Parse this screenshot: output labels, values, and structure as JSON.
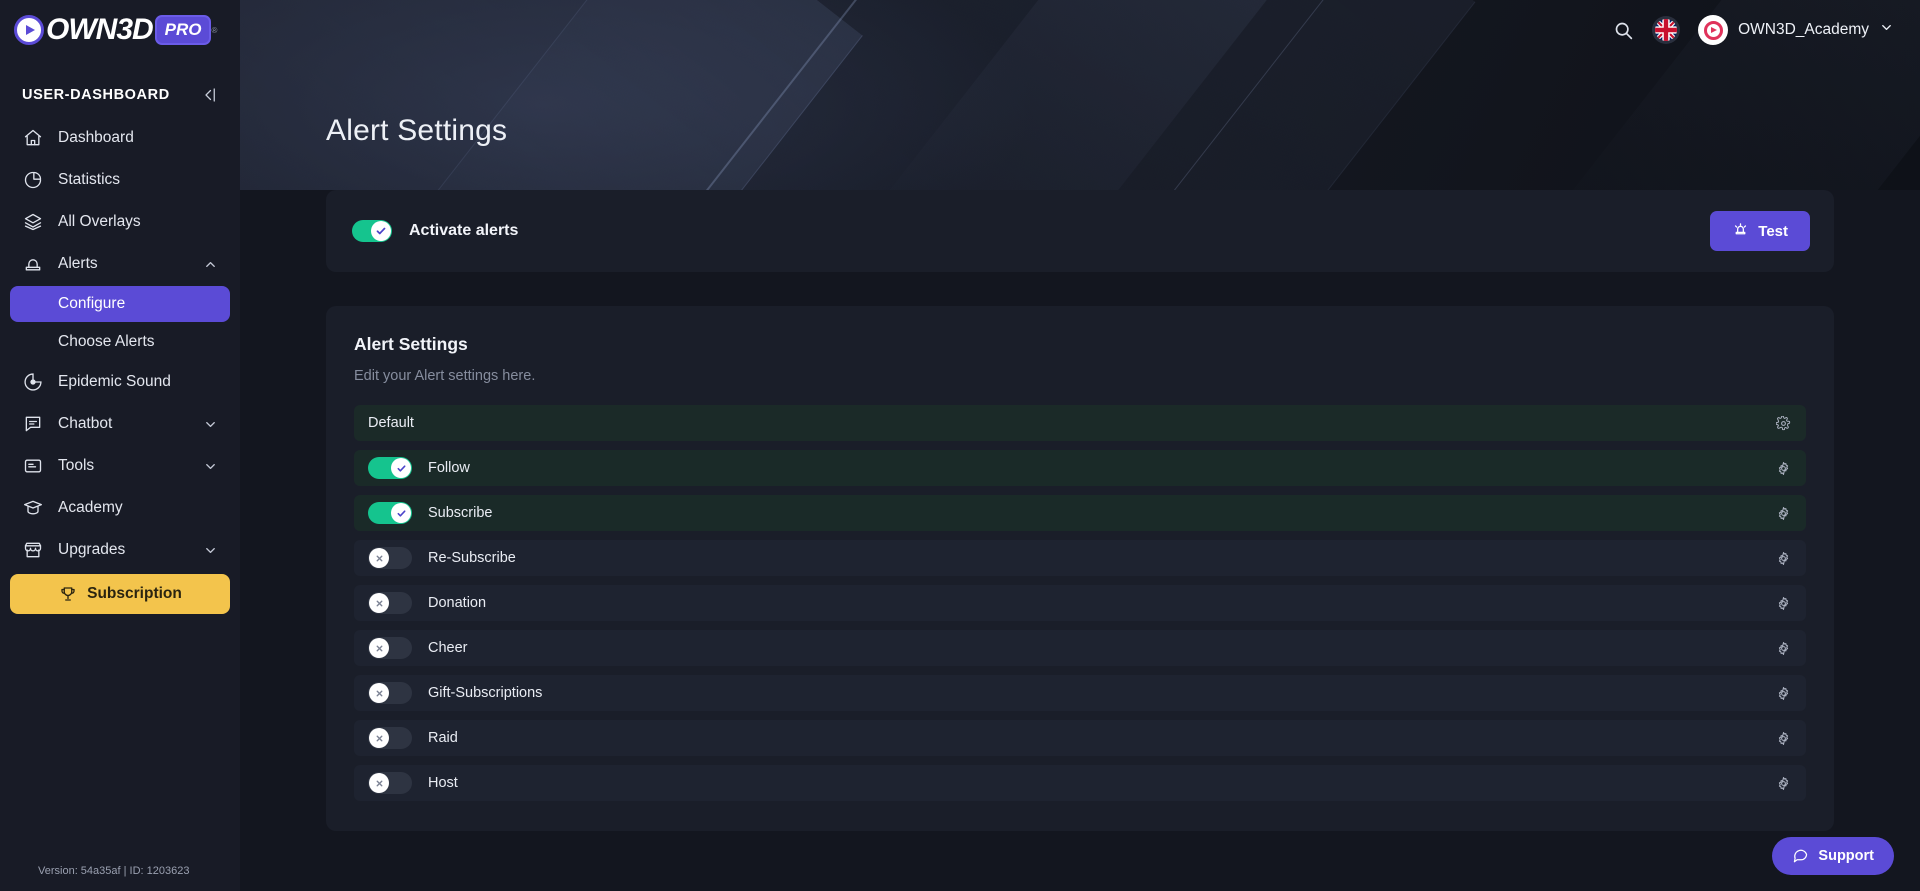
{
  "brand": {
    "logo_text": "OWN3D",
    "logo_badge": "PRO",
    "logo_registered": "®"
  },
  "sidebar": {
    "section_title": "USER-DASHBOARD",
    "collapse_icon": "collapse-left-icon",
    "items": [
      {
        "label": "Dashboard",
        "icon": "home-icon",
        "chevron": ""
      },
      {
        "label": "Statistics",
        "icon": "pie-chart-icon",
        "chevron": ""
      },
      {
        "label": "All Overlays",
        "icon": "layers-icon",
        "chevron": ""
      },
      {
        "label": "Alerts",
        "icon": "alert-light-icon",
        "chevron": "chevron-up-icon"
      },
      {
        "label": "Epidemic Sound",
        "icon": "epidemic-sound-icon",
        "chevron": ""
      },
      {
        "label": "Chatbot",
        "icon": "chat-bubble-icon",
        "chevron": "chevron-down-icon"
      },
      {
        "label": "Tools",
        "icon": "tools-window-icon",
        "chevron": "chevron-down-icon"
      },
      {
        "label": "Academy",
        "icon": "graduation-cap-icon",
        "chevron": ""
      },
      {
        "label": "Upgrades",
        "icon": "store-icon",
        "chevron": "chevron-down-icon"
      }
    ],
    "sub_items": [
      {
        "label": "Configure",
        "active": true
      },
      {
        "label": "Choose Alerts",
        "active": false
      }
    ],
    "subscription": {
      "label": "Subscription",
      "icon": "trophy-icon"
    },
    "version": "Version: 54a35af | ID: 1203623"
  },
  "topbar": {
    "search_icon": "search-icon",
    "language_icon": "uk-flag-icon",
    "avatar_icon": "own3d-avatar-icon",
    "username": "OWN3D_Academy",
    "chevron_icon": "chevron-down-icon"
  },
  "hero": {
    "title": "Alert Settings"
  },
  "activate": {
    "label": "Activate alerts",
    "enabled": true,
    "test_button": "Test",
    "test_icon": "alert-bell-icon"
  },
  "settings": {
    "title": "Alert Settings",
    "subtitle": "Edit your Alert settings here.",
    "default_row": {
      "label": "Default",
      "gear_icon": "gear-icon"
    },
    "rows": [
      {
        "label": "Follow",
        "enabled": true,
        "gear_icon": "gear-icon"
      },
      {
        "label": "Subscribe",
        "enabled": true,
        "gear_icon": "gear-icon"
      },
      {
        "label": "Re-Subscribe",
        "enabled": false,
        "gear_icon": "gear-icon"
      },
      {
        "label": "Donation",
        "enabled": false,
        "gear_icon": "gear-icon"
      },
      {
        "label": "Cheer",
        "enabled": false,
        "gear_icon": "gear-icon"
      },
      {
        "label": "Gift-Subscriptions",
        "enabled": false,
        "gear_icon": "gear-icon"
      },
      {
        "label": "Raid",
        "enabled": false,
        "gear_icon": "gear-icon"
      },
      {
        "label": "Host",
        "enabled": false,
        "gear_icon": "gear-icon"
      }
    ]
  },
  "support": {
    "label": "Support",
    "icon": "chat-bubble-icon"
  },
  "colors": {
    "accent": "#5b4bd6",
    "toggle_on": "#15c48e",
    "subscription": "#f3c44c",
    "page_bg": "#13161f",
    "sidebar_bg": "#181b26",
    "card_bg": "#1a1e29"
  }
}
